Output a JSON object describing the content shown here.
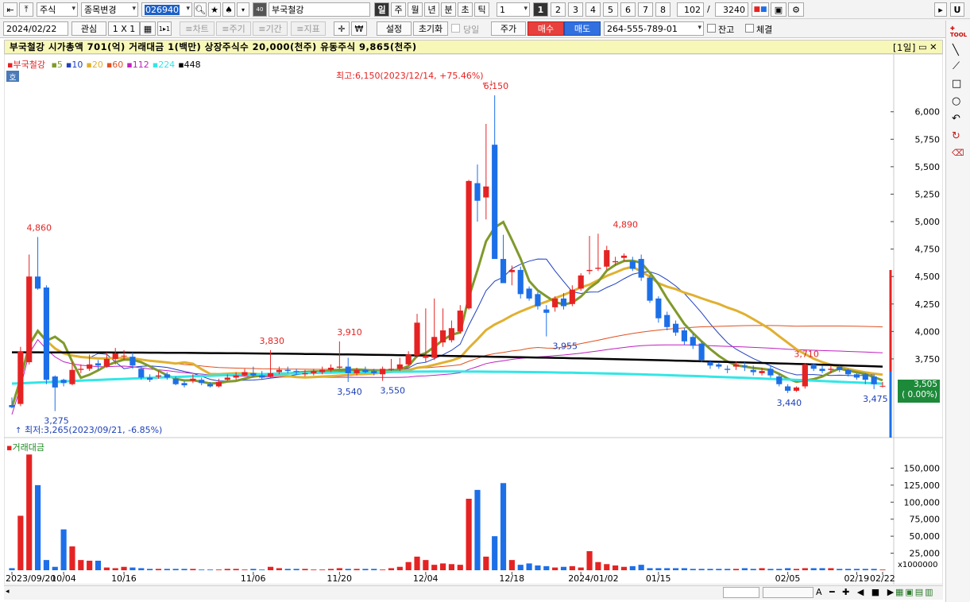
{
  "toolbar": {
    "market": "주식",
    "change_stock": "종목변경",
    "code": "026940",
    "stock_name": "부국철강",
    "periods": [
      "일",
      "주",
      "월",
      "년",
      "분",
      "초",
      "틱"
    ],
    "period_value": "1",
    "quick_numbers": [
      "1",
      "2",
      "3",
      "4",
      "5",
      "6",
      "7",
      "8"
    ],
    "count": "102",
    "slash": "/",
    "total": "3240",
    "date": "2024/02/22",
    "watch": "관심",
    "layout": "1 X 1",
    "layout_btn": "1▸1",
    "chart_btn": "≡차트",
    "price_btn": "≡주기",
    "period_btn": "≡기간",
    "indicator_btn": "≡지표",
    "won": "₩",
    "settings": "설정",
    "reset": "초기화",
    "today": "당일",
    "price": "주가",
    "buy": "매수",
    "sell": "매도",
    "account": "264-555-789-01",
    "balance": "잔고",
    "filled": "체결"
  },
  "colors": {
    "up": "#e52323",
    "down": "#1c6fe8",
    "ma5": "#7f9a2b",
    "ma20": "#e0b030",
    "black": "#000000",
    "cyan": "#33e6e6"
  },
  "pane": {
    "header": "부국철강  시가총액 701(억)  거래대금 1(백만)  상장주식수 20,000(천주)  유동주식 9,865(천주)",
    "period_label": "[1일]"
  },
  "legend": {
    "name": "부국철강",
    "items": [
      {
        "label": "5",
        "color": "#7f9a2b"
      },
      {
        "label": "10",
        "color": "#2040c0"
      },
      {
        "label": "20",
        "color": "#e0b030"
      },
      {
        "label": "60",
        "color": "#e05020"
      },
      {
        "label": "112",
        "color": "#c020c0"
      },
      {
        "label": "224",
        "color": "#33e6e6"
      },
      {
        "label": "448",
        "color": "#000000"
      }
    ],
    "hoga": "호"
  },
  "annotations": {
    "high": "최고:6,150(2023/12/14, +75.46%)",
    "low": "최저:3,265(2023/09/21, -6.85%)",
    "labels": [
      {
        "text": "4,860",
        "x": "2023/09/25",
        "y": 4860,
        "color": "#e52323"
      },
      {
        "text": "3,275",
        "x": "2023/09/27",
        "y": 3275,
        "color": "#1c3fb8"
      },
      {
        "text": "3,830",
        "x": "2023/11/08",
        "y": 3830,
        "color": "#e52323"
      },
      {
        "text": "3,910",
        "x": "2023/11/21",
        "y": 3910,
        "color": "#e52323"
      },
      {
        "text": "3,540",
        "x": "2023/11/21",
        "y": 3540,
        "color": "#1c3fb8"
      },
      {
        "text": "3,550",
        "x": "2023/11/28",
        "y": 3550,
        "color": "#1c3fb8"
      },
      {
        "text": "6,150",
        "x": "2023/12/14",
        "y": 6150,
        "color": "#e52323"
      },
      {
        "text": "3,955",
        "x": "2023/12/27",
        "y": 3955,
        "color": "#1c3fb8"
      },
      {
        "text": "4,890",
        "x": "2024/01/09",
        "y": 4890,
        "color": "#e52323"
      },
      {
        "text": "3,710",
        "x": "2024/02/07",
        "y": 3710,
        "color": "#e52323"
      },
      {
        "text": "3,440",
        "x": "2024/02/05",
        "y": 3440,
        "color": "#1c3fb8"
      },
      {
        "text": "3,475",
        "x": "2024/02/21",
        "y": 3475,
        "color": "#1c3fb8"
      }
    ],
    "current_price": "3,505",
    "current_change": "( 0.00%)",
    "volume_title": "거래대금",
    "volume_unit": "x1000000"
  },
  "chart_data": [
    {
      "type": "candlestick",
      "title": "부국철강",
      "ylim": [
        3250,
        6150
      ],
      "yticks": [
        6000,
        5750,
        5500,
        5250,
        5000,
        4750,
        4500,
        4250,
        4000,
        3750,
        3505
      ],
      "ytick_labels": [
        "6,000",
        "5,750",
        "5,500",
        "5,250",
        "5,000",
        "4,750",
        "4,500",
        "4,250",
        "4,000",
        "3,750"
      ],
      "xtick_labels": [
        "2023/09/20",
        "10/04",
        "10/16",
        "11/06",
        "11/20",
        "12/04",
        "12/18",
        "2024/01/02",
        "01/15",
        "02/05",
        "02/19",
        "02/22"
      ],
      "x": [
        "2023/09/20",
        "2023/09/21",
        "2023/09/22",
        "2023/09/25",
        "2023/09/26",
        "2023/09/27",
        "2023/10/04",
        "2023/10/05",
        "2023/10/06",
        "2023/10/10",
        "2023/10/11",
        "2023/10/12",
        "2023/10/13",
        "2023/10/16",
        "2023/10/17",
        "2023/10/18",
        "2023/10/19",
        "2023/10/20",
        "2023/10/23",
        "2023/10/24",
        "2023/10/25",
        "2023/10/26",
        "2023/10/27",
        "2023/10/30",
        "2023/10/31",
        "2023/11/01",
        "2023/11/02",
        "2023/11/03",
        "2023/11/06",
        "2023/11/07",
        "2023/11/08",
        "2023/11/09",
        "2023/11/10",
        "2023/11/13",
        "2023/11/14",
        "2023/11/15",
        "2023/11/16",
        "2023/11/17",
        "2023/11/20",
        "2023/11/21",
        "2023/11/22",
        "2023/11/23",
        "2023/11/24",
        "2023/11/27",
        "2023/11/28",
        "2023/11/29",
        "2023/11/30",
        "2023/12/01",
        "2023/12/04",
        "2023/12/05",
        "2023/12/06",
        "2023/12/07",
        "2023/12/08",
        "2023/12/11",
        "2023/12/12",
        "2023/12/13",
        "2023/12/14",
        "2023/12/15",
        "2023/12/18",
        "2023/12/19",
        "2023/12/20",
        "2023/12/21",
        "2023/12/22",
        "2023/12/26",
        "2023/12/27",
        "2023/12/28",
        "2024/01/02",
        "2024/01/03",
        "2024/01/04",
        "2024/01/05",
        "2024/01/08",
        "2024/01/09",
        "2024/01/10",
        "2024/01/11",
        "2024/01/12",
        "2024/01/15",
        "2024/01/16",
        "2024/01/17",
        "2024/01/18",
        "2024/01/19",
        "2024/01/22",
        "2024/01/23",
        "2024/01/24",
        "2024/01/25",
        "2024/01/26",
        "2024/01/29",
        "2024/01/30",
        "2024/01/31",
        "2024/02/01",
        "2024/02/02",
        "2024/02/05",
        "2024/02/06",
        "2024/02/07",
        "2024/02/08",
        "2024/02/13",
        "2024/02/14",
        "2024/02/15",
        "2024/02/16",
        "2024/02/19",
        "2024/02/20",
        "2024/02/21",
        "2024/02/22"
      ],
      "open": [
        3330,
        3340,
        3720,
        4500,
        4400,
        3590,
        3560,
        3520,
        3650,
        3660,
        3710,
        3680,
        3750,
        3780,
        3770,
        3660,
        3580,
        3590,
        3610,
        3570,
        3530,
        3550,
        3560,
        3520,
        3500,
        3560,
        3580,
        3600,
        3620,
        3600,
        3590,
        3630,
        3650,
        3640,
        3610,
        3620,
        3630,
        3650,
        3670,
        3680,
        3620,
        3650,
        3640,
        3610,
        3650,
        3660,
        3700,
        3780,
        3760,
        3760,
        3900,
        3920,
        4000,
        4210,
        5350,
        5220,
        5700,
        4660,
        4540,
        4560,
        4390,
        4340,
        4200,
        4220,
        4300,
        4250,
        4390,
        4550,
        4570,
        4590,
        4630,
        4670,
        4640,
        4660,
        4490,
        4300,
        4150,
        4070,
        4010,
        3950,
        3890,
        3720,
        3700,
        3660,
        3680,
        3690,
        3650,
        3620,
        3660,
        3590,
        3500,
        3460,
        3500,
        3700,
        3660,
        3650,
        3680,
        3650,
        3610,
        3610,
        3590,
        3505
      ],
      "close": [
        3310,
        3820,
        4500,
        4390,
        3560,
        3490,
        3530,
        3650,
        3660,
        3700,
        3690,
        3750,
        3800,
        3780,
        3690,
        3580,
        3560,
        3600,
        3580,
        3520,
        3510,
        3570,
        3530,
        3500,
        3540,
        3580,
        3600,
        3630,
        3600,
        3580,
        3620,
        3650,
        3640,
        3630,
        3620,
        3640,
        3650,
        3670,
        3680,
        3620,
        3650,
        3630,
        3620,
        3660,
        3660,
        3700,
        3790,
        4080,
        3780,
        3950,
        4010,
        4030,
        4190,
        5370,
        5190,
        5320,
        4660,
        4440,
        4560,
        4340,
        4300,
        4230,
        4170,
        4300,
        4230,
        4380,
        4510,
        4560,
        4580,
        4740,
        4640,
        4690,
        4570,
        4490,
        4280,
        4120,
        4040,
        3990,
        3910,
        3870,
        3740,
        3690,
        3680,
        3650,
        3700,
        3680,
        3630,
        3640,
        3600,
        3520,
        3460,
        3490,
        3700,
        3660,
        3640,
        3660,
        3650,
        3610,
        3580,
        3560,
        3520,
        3505
      ],
      "high": [
        3400,
        3860,
        4700,
        4860,
        4420,
        3600,
        3570,
        3720,
        3700,
        3790,
        3740,
        3810,
        3850,
        3830,
        3810,
        3680,
        3610,
        3640,
        3630,
        3590,
        3550,
        3610,
        3580,
        3540,
        3570,
        3610,
        3630,
        3660,
        3680,
        3640,
        3830,
        3680,
        3680,
        3660,
        3650,
        3660,
        3680,
        3700,
        3910,
        3760,
        3670,
        3680,
        3660,
        3680,
        3750,
        3760,
        3820,
        4160,
        4210,
        4300,
        4210,
        4100,
        4240,
        5380,
        5520,
        5890,
        6150,
        4880,
        4600,
        4590,
        4410,
        4360,
        4240,
        4320,
        4350,
        4420,
        4530,
        4870,
        4890,
        4780,
        4680,
        4710,
        4680,
        4700,
        4510,
        4320,
        4180,
        4100,
        4030,
        3980,
        3910,
        3740,
        3720,
        3690,
        3730,
        3720,
        3690,
        3670,
        3690,
        3610,
        3520,
        3500,
        3710,
        3710,
        3690,
        3690,
        3690,
        3660,
        3620,
        3620,
        3610,
        3540
      ],
      "low": [
        3300,
        3320,
        3700,
        4380,
        3520,
        3275,
        3500,
        3510,
        3620,
        3640,
        3650,
        3670,
        3700,
        3740,
        3660,
        3560,
        3540,
        3570,
        3560,
        3510,
        3490,
        3530,
        3510,
        3490,
        3490,
        3550,
        3560,
        3590,
        3580,
        3560,
        3580,
        3610,
        3620,
        3610,
        3590,
        3600,
        3610,
        3630,
        3660,
        3540,
        3600,
        3620,
        3600,
        3550,
        3640,
        3640,
        3690,
        3760,
        3720,
        3740,
        3860,
        3900,
        3980,
        4200,
        5000,
        5020,
        4990,
        4600,
        4420,
        4300,
        4280,
        4200,
        3955,
        4180,
        4200,
        4230,
        4370,
        4520,
        4550,
        4560,
        4600,
        4640,
        4550,
        4460,
        4260,
        4080,
        4010,
        3960,
        3880,
        3840,
        3720,
        3660,
        3660,
        3620,
        3650,
        3640,
        3600,
        3600,
        3580,
        3500,
        3440,
        3450,
        3480,
        3640,
        3620,
        3620,
        3630,
        3590,
        3560,
        3520,
        3475,
        3490
      ],
      "value": [
        3,
        80,
        170,
        125,
        15,
        5,
        60,
        35,
        15,
        14,
        14,
        4,
        3,
        5,
        4,
        3,
        2,
        2,
        2,
        2,
        2,
        2,
        1,
        1,
        1,
        2,
        2,
        1,
        2,
        1,
        5,
        3,
        2,
        2,
        2,
        1,
        1,
        2,
        3,
        2,
        2,
        2,
        2,
        1,
        3,
        5,
        12,
        20,
        15,
        8,
        10,
        9,
        8,
        105,
        118,
        20,
        50,
        128,
        15,
        8,
        10,
        7,
        6,
        4,
        5,
        6,
        4,
        28,
        12,
        9,
        7,
        5,
        6,
        8,
        3,
        3,
        3,
        3,
        3,
        2,
        2,
        2,
        2,
        2,
        2,
        3,
        2,
        3,
        2,
        2,
        3,
        2,
        3,
        3,
        3,
        3,
        2,
        2,
        2,
        2,
        2,
        1
      ]
    }
  ]
}
